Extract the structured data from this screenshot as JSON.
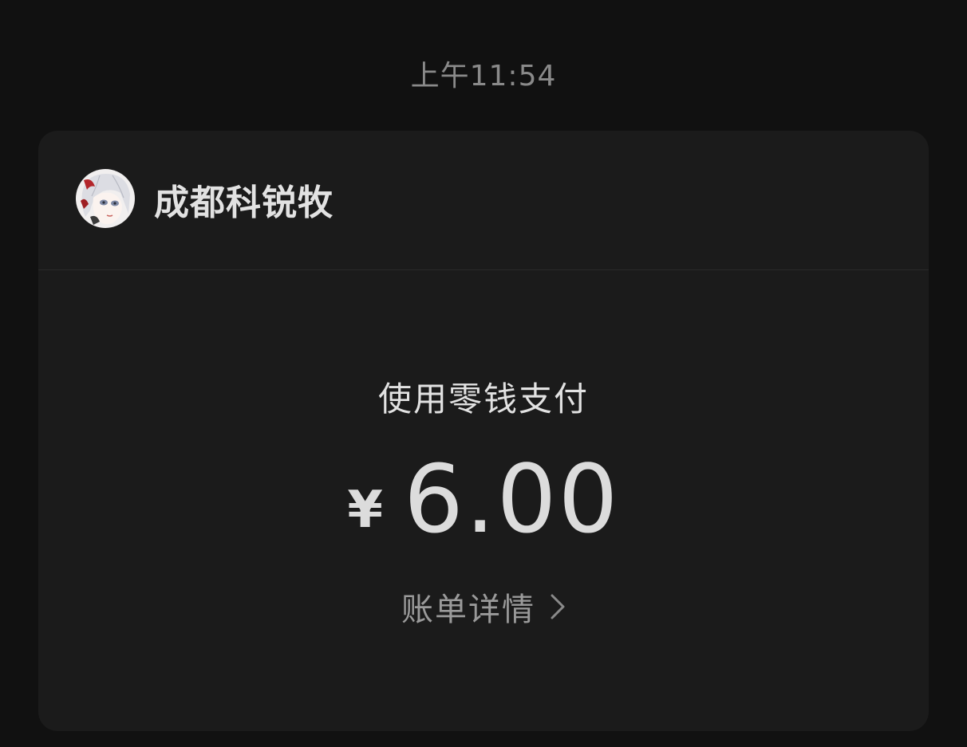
{
  "timestamp": "上午11:54",
  "payment_card": {
    "merchant": {
      "name": "成都科锐牧",
      "avatar_icon": "anime-character-avatar"
    },
    "payment_method": "使用零钱支付",
    "currency_symbol": "¥",
    "amount": "6.00",
    "detail_link_label": "账单详情",
    "detail_link_icon": "chevron-right-icon"
  },
  "colors": {
    "page_background": "#111111",
    "card_background": "#1b1b1b",
    "primary_text": "#e2e2e2",
    "secondary_text": "#9a9a9a",
    "timestamp_text": "#8a8a8a"
  }
}
